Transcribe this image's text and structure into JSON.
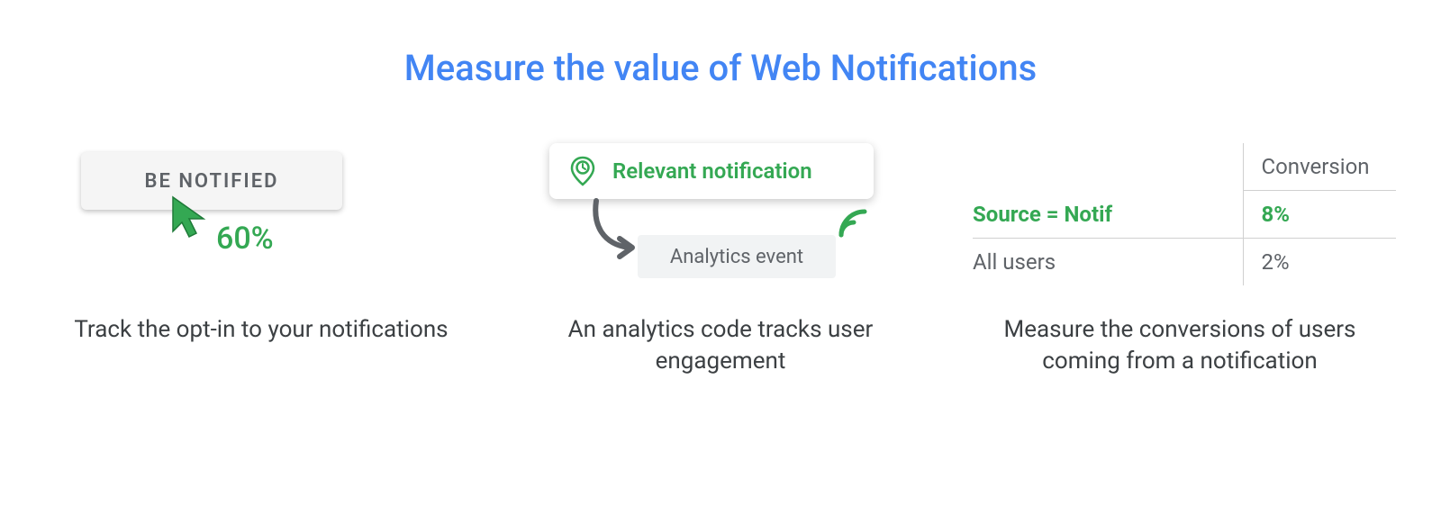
{
  "title": "Measure the value of Web Notifications",
  "col1": {
    "button_label": "BE NOTIFIED",
    "optin_pct": "60%",
    "caption": "Track the opt-in to your notifications"
  },
  "col2": {
    "notif_label": "Relevant notification",
    "event_label": "Analytics event",
    "caption": "An analytics code tracks user engagement"
  },
  "col3": {
    "header_col2": "Conversion",
    "row1_label": "Source = Notif",
    "row1_value": "8%",
    "row2_label": "All users",
    "row2_value": "2%",
    "caption": "Measure the conversions of users coming from a notification"
  },
  "colors": {
    "green": "#34a853",
    "blue": "#4285f4"
  }
}
